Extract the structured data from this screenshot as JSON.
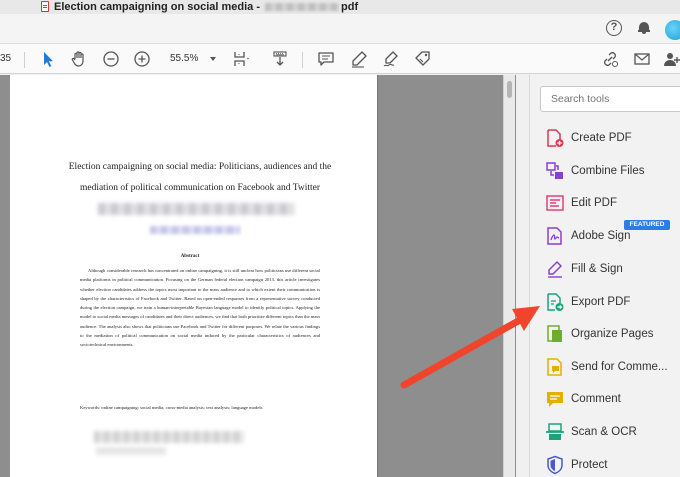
{
  "window": {
    "title_prefix": "Election campaigning on social media - ",
    "title_suffix": "pdf"
  },
  "toolbar": {
    "page_number": "35",
    "zoom_value": "55.5%"
  },
  "document": {
    "title": "Election campaigning on social media: Politicians, audiences and the mediation of political communication on Facebook and Twitter",
    "abstract_heading": "Abstract",
    "abstract_body": "Although considerable research has concentrated on online campaigning, it is still unclear how politicians use different social media platforms in political communication. Focusing on the German federal election campaign 2013, this article investigates whether election candidates address the topics most important to the mass audience and to which extent their communication is shaped by the characteristics of Facebook and Twitter. Based on open-ended responses from a representative survey conducted during the election campaign, we train a human-interpretable Bayesian language model to identify political topics. Applying the model to social media messages of candidates and their direct audiences, we find that both prioritize different topics than the mass audience. The analysis also shows that politicians use Facebook and Twitter for different purposes. We relate the various findings to the mediation of political communication on social media induced by the particular characteristics of audiences and sociotechnical environments.",
    "keywords": "Keywords: online campaigning; social media; cross-media analysis; text analysis; language models"
  },
  "tool_pane": {
    "search_placeholder": "Search tools",
    "featured_badge": "FEATURED",
    "tools": [
      {
        "label": "Create PDF"
      },
      {
        "label": "Combine Files"
      },
      {
        "label": "Edit PDF"
      },
      {
        "label": "Adobe Sign"
      },
      {
        "label": "Fill & Sign"
      },
      {
        "label": "Export PDF"
      },
      {
        "label": "Organize Pages"
      },
      {
        "label": "Send for Comme..."
      },
      {
        "label": "Comment"
      },
      {
        "label": "Scan & OCR"
      },
      {
        "label": "Protect"
      }
    ]
  },
  "colors": {
    "arrow": "#f0442c",
    "featured": "#2d7be5",
    "create_pdf": "#e0364f",
    "combine": "#8b3fd0",
    "edit": "#e0427a",
    "sign": "#8b3fd0",
    "fill_sign": "#8b3fd0",
    "export": "#1aa37a",
    "organize": "#6fae2b",
    "send": "#e3b000",
    "comment": "#e3b000",
    "scan": "#1aa37a",
    "protect": "#4b58c8"
  }
}
